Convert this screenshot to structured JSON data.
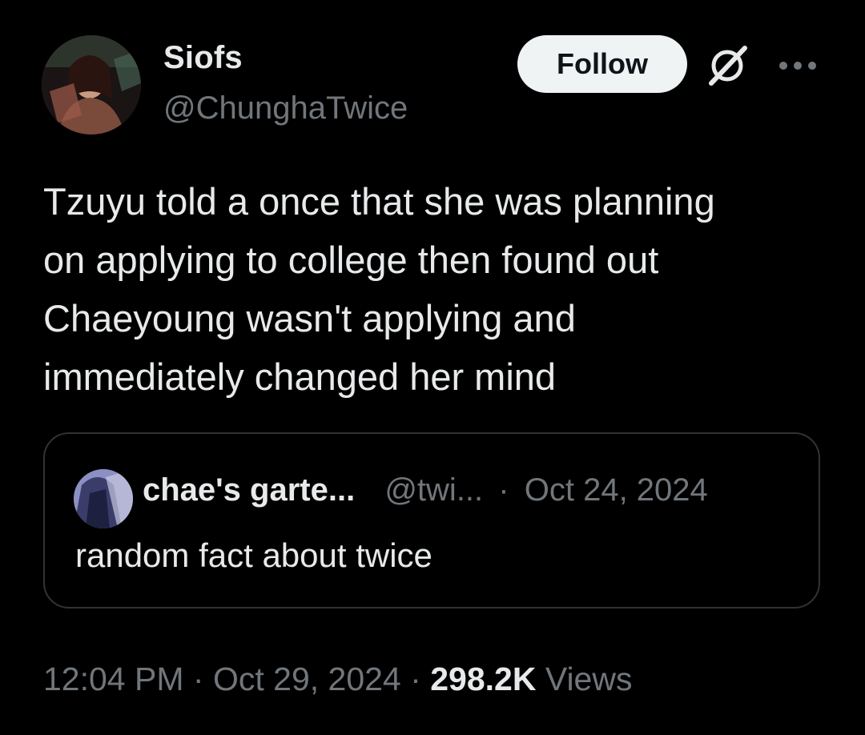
{
  "author": {
    "display_name": "Siofs",
    "handle": "@ChunghaTwice"
  },
  "actions": {
    "follow_label": "Follow",
    "grok_icon": "grok-icon",
    "more_icon": "more-icon"
  },
  "tweet": {
    "text": "Tzuyu told a once that she was planning\non applying to college then found out\nChaeyoung wasn't applying and\nimmediately changed her mind"
  },
  "quote": {
    "name": "chae's garte...",
    "handle": "@twi...",
    "separator": "·",
    "date": "Oct 24, 2024",
    "text": "random fact about twice"
  },
  "footer": {
    "time": "12:04 PM",
    "separator1": "·",
    "date": "Oct 29, 2024",
    "separator2": "·",
    "views_count": "298.2K",
    "views_label": "Views"
  },
  "colors": {
    "background": "#000000",
    "primary_text": "#e7e9ea",
    "secondary_text": "#71767b",
    "border": "#2f3336",
    "follow_bg": "#eff3f4"
  }
}
